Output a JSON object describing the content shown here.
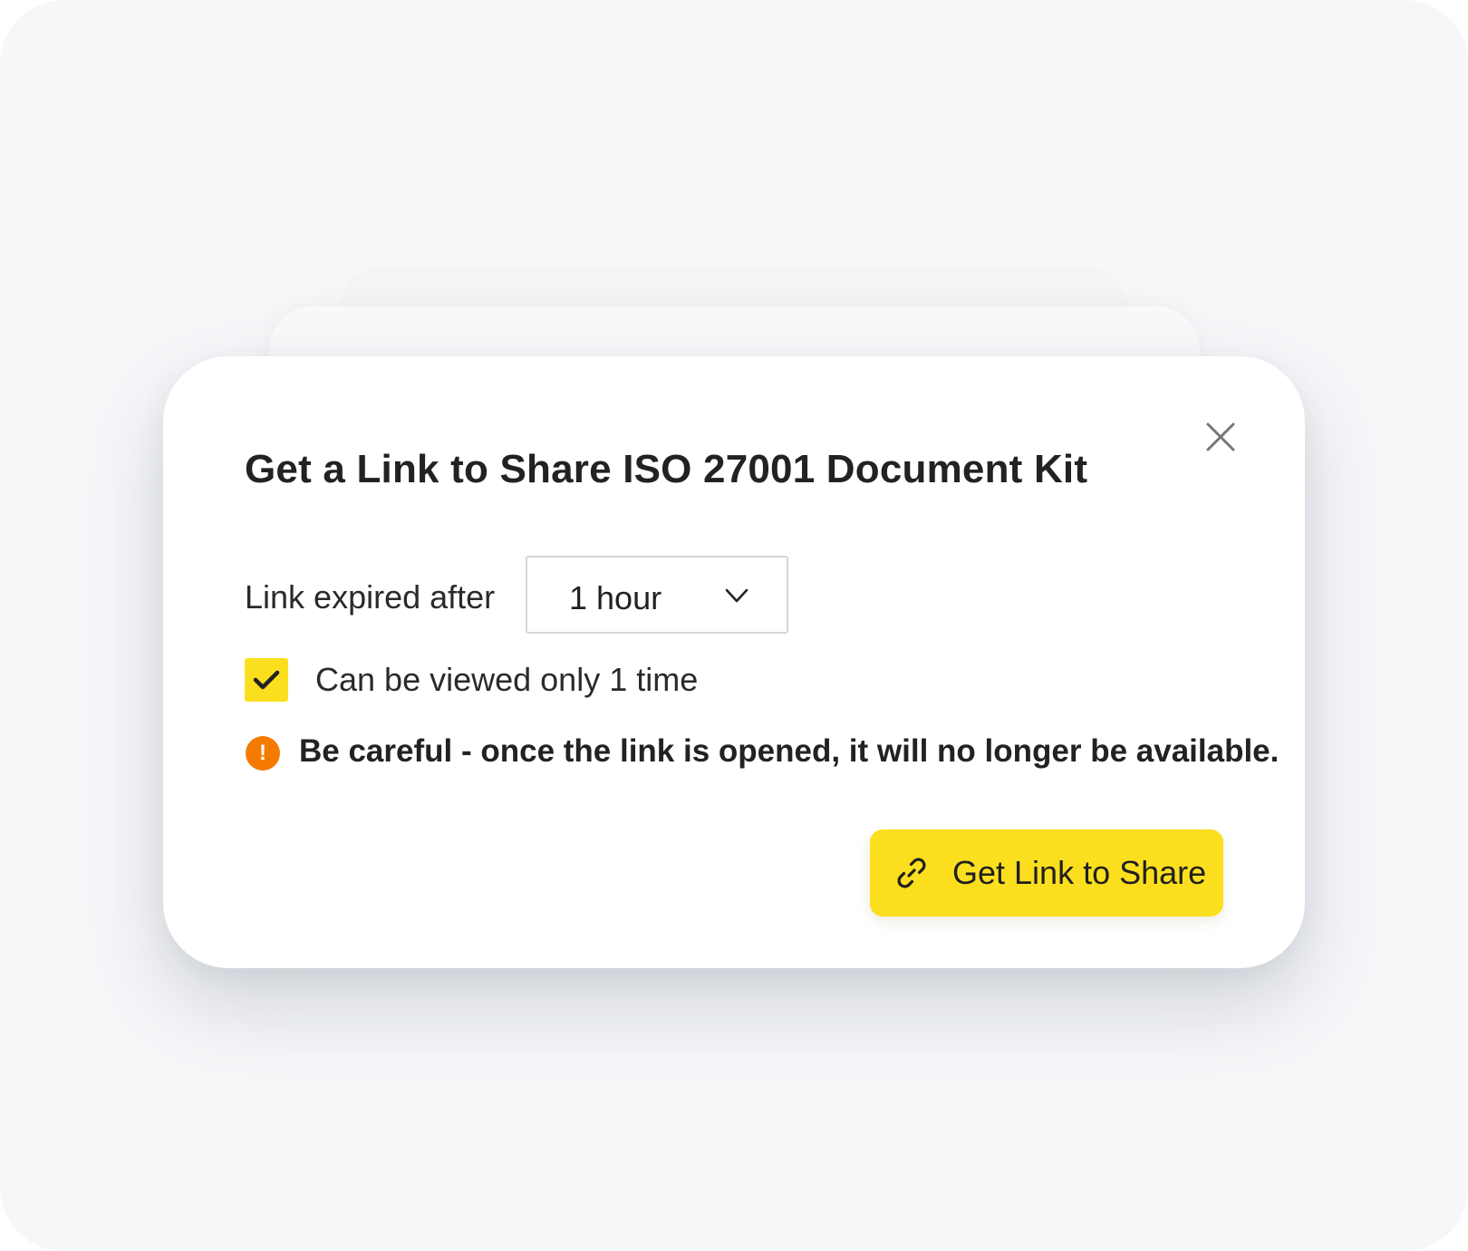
{
  "dialog": {
    "title": "Get a Link to Share ISO 27001 Document Kit",
    "close_icon": "close-icon"
  },
  "expiration": {
    "label": "Link expired after",
    "selected_value": "1 hour",
    "chevron_icon": "chevron-down-icon"
  },
  "view_once": {
    "label": "Can be viewed only 1 time",
    "checked": true,
    "check_icon": "checkmark-icon"
  },
  "warning": {
    "icon": "exclamation-icon",
    "icon_glyph": "!",
    "text": "Be careful - once the link is opened, it will no longer be available."
  },
  "action": {
    "label": "Get Link to Share",
    "icon": "link-icon"
  },
  "colors": {
    "accent_yellow": "#FBDF1E",
    "warning_orange": "#F47B00",
    "text_dark": "#222222",
    "background": "#F6F7F9"
  }
}
